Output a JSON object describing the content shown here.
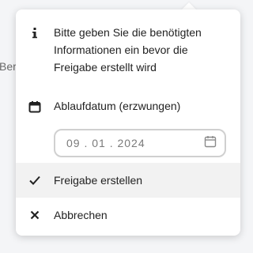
{
  "background": {
    "partial_text": "Ber"
  },
  "popover": {
    "info": {
      "icon": "info-icon",
      "text_line1": "Bitte geben Sie die benötigten",
      "text_line2": "Informationen ein bevor die",
      "text_line3": "Freigabe erstellt wird"
    },
    "expiration": {
      "icon": "calendar-icon",
      "label": "Ablaufdatum (erzwungen)"
    },
    "date_field": {
      "value": "09 . 01 . 2024",
      "icon": "calendar-icon"
    },
    "actions": {
      "create_label": "Freigabe erstellen",
      "create_icon": "checkmark-icon",
      "cancel_label": "Abbrechen",
      "cancel_icon": "close-icon"
    }
  },
  "colors": {
    "popover_bg": "#ffffff",
    "text": "#222222",
    "hover_bg": "#f2f2f2",
    "input_border": "#d0d0d0"
  }
}
